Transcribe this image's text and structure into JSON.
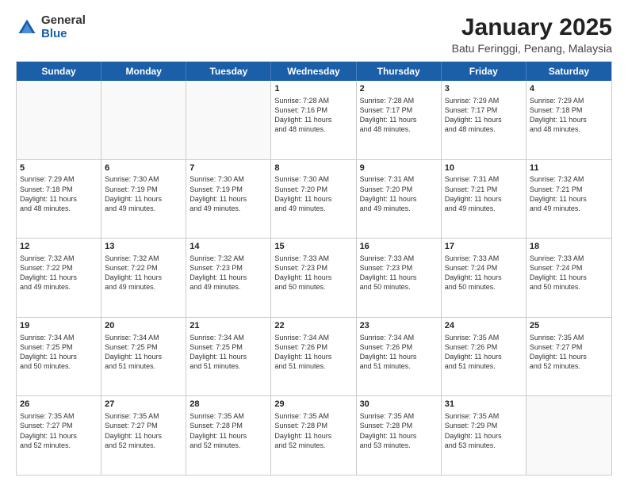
{
  "logo": {
    "general": "General",
    "blue": "Blue"
  },
  "title": "January 2025",
  "subtitle": "Batu Feringgi, Penang, Malaysia",
  "headers": [
    "Sunday",
    "Monday",
    "Tuesday",
    "Wednesday",
    "Thursday",
    "Friday",
    "Saturday"
  ],
  "weeks": [
    [
      {
        "day": "",
        "info": ""
      },
      {
        "day": "",
        "info": ""
      },
      {
        "day": "",
        "info": ""
      },
      {
        "day": "1",
        "info": "Sunrise: 7:28 AM\nSunset: 7:16 PM\nDaylight: 11 hours\nand 48 minutes."
      },
      {
        "day": "2",
        "info": "Sunrise: 7:28 AM\nSunset: 7:17 PM\nDaylight: 11 hours\nand 48 minutes."
      },
      {
        "day": "3",
        "info": "Sunrise: 7:29 AM\nSunset: 7:17 PM\nDaylight: 11 hours\nand 48 minutes."
      },
      {
        "day": "4",
        "info": "Sunrise: 7:29 AM\nSunset: 7:18 PM\nDaylight: 11 hours\nand 48 minutes."
      }
    ],
    [
      {
        "day": "5",
        "info": "Sunrise: 7:29 AM\nSunset: 7:18 PM\nDaylight: 11 hours\nand 48 minutes."
      },
      {
        "day": "6",
        "info": "Sunrise: 7:30 AM\nSunset: 7:19 PM\nDaylight: 11 hours\nand 49 minutes."
      },
      {
        "day": "7",
        "info": "Sunrise: 7:30 AM\nSunset: 7:19 PM\nDaylight: 11 hours\nand 49 minutes."
      },
      {
        "day": "8",
        "info": "Sunrise: 7:30 AM\nSunset: 7:20 PM\nDaylight: 11 hours\nand 49 minutes."
      },
      {
        "day": "9",
        "info": "Sunrise: 7:31 AM\nSunset: 7:20 PM\nDaylight: 11 hours\nand 49 minutes."
      },
      {
        "day": "10",
        "info": "Sunrise: 7:31 AM\nSunset: 7:21 PM\nDaylight: 11 hours\nand 49 minutes."
      },
      {
        "day": "11",
        "info": "Sunrise: 7:32 AM\nSunset: 7:21 PM\nDaylight: 11 hours\nand 49 minutes."
      }
    ],
    [
      {
        "day": "12",
        "info": "Sunrise: 7:32 AM\nSunset: 7:22 PM\nDaylight: 11 hours\nand 49 minutes."
      },
      {
        "day": "13",
        "info": "Sunrise: 7:32 AM\nSunset: 7:22 PM\nDaylight: 11 hours\nand 49 minutes."
      },
      {
        "day": "14",
        "info": "Sunrise: 7:32 AM\nSunset: 7:23 PM\nDaylight: 11 hours\nand 49 minutes."
      },
      {
        "day": "15",
        "info": "Sunrise: 7:33 AM\nSunset: 7:23 PM\nDaylight: 11 hours\nand 50 minutes."
      },
      {
        "day": "16",
        "info": "Sunrise: 7:33 AM\nSunset: 7:23 PM\nDaylight: 11 hours\nand 50 minutes."
      },
      {
        "day": "17",
        "info": "Sunrise: 7:33 AM\nSunset: 7:24 PM\nDaylight: 11 hours\nand 50 minutes."
      },
      {
        "day": "18",
        "info": "Sunrise: 7:33 AM\nSunset: 7:24 PM\nDaylight: 11 hours\nand 50 minutes."
      }
    ],
    [
      {
        "day": "19",
        "info": "Sunrise: 7:34 AM\nSunset: 7:25 PM\nDaylight: 11 hours\nand 50 minutes."
      },
      {
        "day": "20",
        "info": "Sunrise: 7:34 AM\nSunset: 7:25 PM\nDaylight: 11 hours\nand 51 minutes."
      },
      {
        "day": "21",
        "info": "Sunrise: 7:34 AM\nSunset: 7:25 PM\nDaylight: 11 hours\nand 51 minutes."
      },
      {
        "day": "22",
        "info": "Sunrise: 7:34 AM\nSunset: 7:26 PM\nDaylight: 11 hours\nand 51 minutes."
      },
      {
        "day": "23",
        "info": "Sunrise: 7:34 AM\nSunset: 7:26 PM\nDaylight: 11 hours\nand 51 minutes."
      },
      {
        "day": "24",
        "info": "Sunrise: 7:35 AM\nSunset: 7:26 PM\nDaylight: 11 hours\nand 51 minutes."
      },
      {
        "day": "25",
        "info": "Sunrise: 7:35 AM\nSunset: 7:27 PM\nDaylight: 11 hours\nand 52 minutes."
      }
    ],
    [
      {
        "day": "26",
        "info": "Sunrise: 7:35 AM\nSunset: 7:27 PM\nDaylight: 11 hours\nand 52 minutes."
      },
      {
        "day": "27",
        "info": "Sunrise: 7:35 AM\nSunset: 7:27 PM\nDaylight: 11 hours\nand 52 minutes."
      },
      {
        "day": "28",
        "info": "Sunrise: 7:35 AM\nSunset: 7:28 PM\nDaylight: 11 hours\nand 52 minutes."
      },
      {
        "day": "29",
        "info": "Sunrise: 7:35 AM\nSunset: 7:28 PM\nDaylight: 11 hours\nand 52 minutes."
      },
      {
        "day": "30",
        "info": "Sunrise: 7:35 AM\nSunset: 7:28 PM\nDaylight: 11 hours\nand 53 minutes."
      },
      {
        "day": "31",
        "info": "Sunrise: 7:35 AM\nSunset: 7:29 PM\nDaylight: 11 hours\nand 53 minutes."
      },
      {
        "day": "",
        "info": ""
      }
    ]
  ]
}
